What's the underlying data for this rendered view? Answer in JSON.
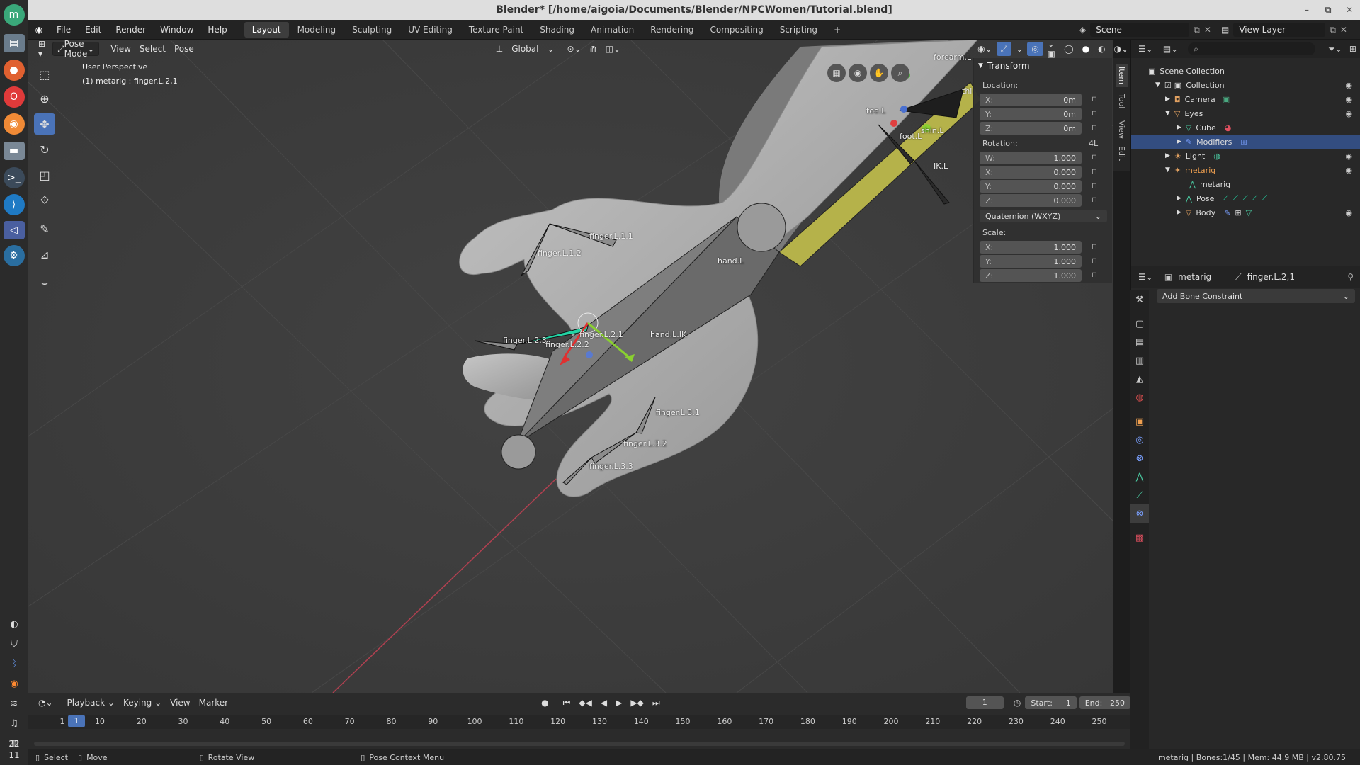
{
  "window": {
    "title": "Blender* [/home/aigoia/Documents/Blender/NPCWomen/Tutorial.blend]"
  },
  "menu": [
    "File",
    "Edit",
    "Render",
    "Window",
    "Help"
  ],
  "workspaces": [
    "Layout",
    "Modeling",
    "Sculpting",
    "UV Editing",
    "Texture Paint",
    "Shading",
    "Animation",
    "Rendering",
    "Compositing",
    "Scripting"
  ],
  "scene_name": "Scene",
  "view_layer": "View Layer",
  "viewport": {
    "mode": "Pose Mode",
    "menus": [
      "View",
      "Select",
      "Pose"
    ],
    "orientation": "Global",
    "overlay_title": "User Perspective",
    "overlay_sub": "(1) metarig : finger.L.2,1"
  },
  "tabs_vertical": [
    "Item",
    "Tool",
    "View",
    "Edit"
  ],
  "bones": [
    "finger.L.1.1",
    "finger.L.1.2",
    "hand.L",
    "finger.L.2.1",
    "finger.L.2.2",
    "finger.L.2.3",
    "hand.L.IK",
    "finger.L.3.1",
    "finger.L.3.2",
    "finger.L.3.3",
    "forearm.L",
    "toe.L",
    "foot.L",
    "shin.L",
    "IK.L",
    "thi"
  ],
  "transform": {
    "title": "Transform",
    "location_label": "Location:",
    "location": [
      {
        "axis": "X:",
        "value": "0m"
      },
      {
        "axis": "Y:",
        "value": "0m"
      },
      {
        "axis": "Z:",
        "value": "0m"
      }
    ],
    "rotation_label": "Rotation:",
    "rotation_mode_badge": "4L",
    "rotation": [
      {
        "axis": "W:",
        "value": "1.000"
      },
      {
        "axis": "X:",
        "value": "0.000"
      },
      {
        "axis": "Y:",
        "value": "0.000"
      },
      {
        "axis": "Z:",
        "value": "0.000"
      }
    ],
    "rotation_mode": "Quaternion (WXYZ)",
    "scale_label": "Scale:",
    "scale": [
      {
        "axis": "X:",
        "value": "1.000"
      },
      {
        "axis": "Y:",
        "value": "1.000"
      },
      {
        "axis": "Z:",
        "value": "1.000"
      }
    ]
  },
  "outliner": {
    "root": "Scene Collection",
    "items": [
      {
        "label": "Collection",
        "indent": 1
      },
      {
        "label": "Camera",
        "indent": 2
      },
      {
        "label": "Eyes",
        "indent": 2
      },
      {
        "label": "Cube",
        "indent": 3
      },
      {
        "label": "Modifiers",
        "indent": 3
      },
      {
        "label": "Light",
        "indent": 2
      },
      {
        "label": "metarig",
        "indent": 2
      },
      {
        "label": "metarig",
        "indent": 3
      },
      {
        "label": "Pose",
        "indent": 3
      },
      {
        "label": "Body",
        "indent": 3
      }
    ]
  },
  "properties": {
    "object": "metarig",
    "bone": "finger.L.2,1",
    "add_constraint": "Add Bone Constraint"
  },
  "timeline": {
    "menus": [
      "Playback",
      "Keying",
      "View",
      "Marker"
    ],
    "current_frame": "1",
    "start_label": "Start:",
    "start": "1",
    "end_label": "End:",
    "end": "250",
    "ticks": [
      "1",
      "10",
      "20",
      "30",
      "40",
      "50",
      "60",
      "70",
      "80",
      "90",
      "100",
      "110",
      "120",
      "130",
      "140",
      "150",
      "160",
      "170",
      "180",
      "190",
      "200",
      "210",
      "220",
      "230",
      "240",
      "250"
    ]
  },
  "statusbar": {
    "select": "Select",
    "move": "Move",
    "rotate": "Rotate View",
    "context": "Pose Context Menu",
    "info": "metarig | Bones:1/45 | Mem: 44.9 MB | v2.80.75"
  },
  "dock": {
    "clock_top": "22",
    "clock_bottom": "11"
  },
  "colors": {
    "accent": "#4a73b8",
    "selection": "#334d80",
    "bone_highlight": "#22d4a4"
  }
}
